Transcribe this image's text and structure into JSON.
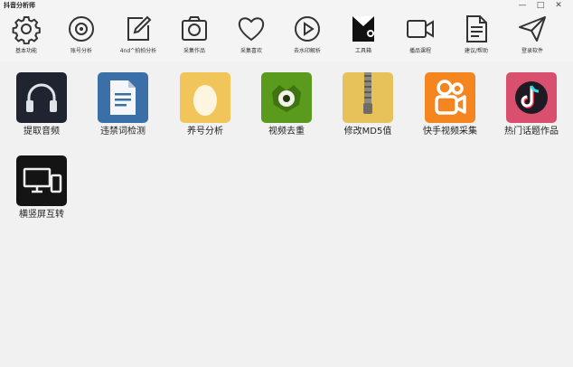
{
  "window": {
    "title": "抖音分析师",
    "controls": {
      "minimize": "—",
      "maximize": "□",
      "close": "✕"
    }
  },
  "toolbar": [
    {
      "label": "基本功能",
      "icon": "gear-icon"
    },
    {
      "label": "账号分析",
      "icon": "target-icon"
    },
    {
      "label": "4nd^拍拍分析",
      "icon": "edit-icon"
    },
    {
      "label": "采集作品",
      "icon": "camera-icon"
    },
    {
      "label": "采集喜欢",
      "icon": "heart-icon"
    },
    {
      "label": "去水印解析",
      "icon": "play-icon"
    },
    {
      "label": "工具箱",
      "icon": "toolbox-icon",
      "active": true
    },
    {
      "label": "播品课程",
      "icon": "video-icon"
    },
    {
      "label": "建议/帮助",
      "icon": "document-icon"
    },
    {
      "label": "登录软件",
      "icon": "send-icon"
    }
  ],
  "tools": [
    {
      "label": "提取音频",
      "icon": "headphones-icon",
      "color": "#1f2430"
    },
    {
      "label": "违禁词检测",
      "icon": "document-icon",
      "color": "#3a6fa8"
    },
    {
      "label": "养号分析",
      "icon": "egg-icon",
      "color": "#f2c55b"
    },
    {
      "label": "视频去重",
      "icon": "monster-icon",
      "color": "#5a9a1d"
    },
    {
      "label": "修改MD5值",
      "icon": "zip-icon",
      "color": "#e7c25a"
    },
    {
      "label": "快手视频采集",
      "icon": "kuaishou-icon",
      "color": "#f5861f"
    },
    {
      "label": "热门话题作品",
      "icon": "tiktok-icon",
      "color": "#d94f6e"
    },
    {
      "label": "横竖屏互转",
      "icon": "monitor-phone-icon",
      "color": "#141414"
    }
  ]
}
